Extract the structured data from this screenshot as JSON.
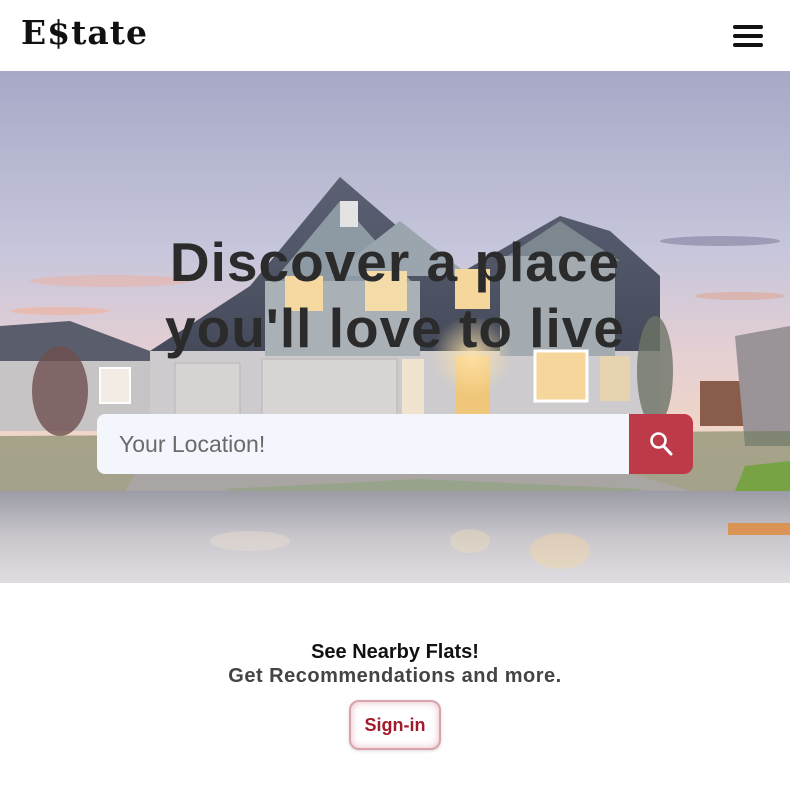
{
  "header": {
    "logo_text": "E$tate",
    "menu_icon": "hamburger-menu-icon"
  },
  "hero": {
    "title_line1": "Discover a place",
    "title_line2": "you'll love to live",
    "background_image": "suburban-house-at-dusk"
  },
  "search": {
    "placeholder": "Your Location!",
    "value": "",
    "button_icon": "search-icon"
  },
  "cta": {
    "title": "See Nearby Flats!",
    "subtitle": "Get Recommendations and more.",
    "signin_label": "Sign-in"
  },
  "colors": {
    "accent": "#bd3a49",
    "signin_text": "#a01b2c",
    "search_bg": "#f3f6fc"
  }
}
